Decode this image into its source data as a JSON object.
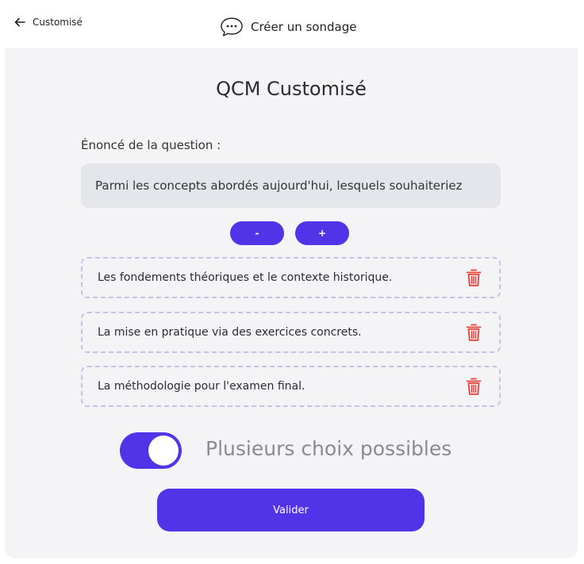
{
  "header": {
    "back_label": "Customisé",
    "title": "Créer un sondage"
  },
  "page_title": "QCM Customisé",
  "question": {
    "label": "Énoncé de la question :",
    "value": "Parmi les concepts abordés aujourd'hui, lesquels souhaiteriez"
  },
  "controls": {
    "minus_label": "-",
    "plus_label": "+"
  },
  "options": [
    {
      "text": "Les fondements théoriques et le contexte historique."
    },
    {
      "text": "La mise en pratique via des exercices concrets."
    },
    {
      "text": "La méthodologie pour l'examen final."
    }
  ],
  "multiple_choice": {
    "label": "Plusieurs choix possibles",
    "enabled": true
  },
  "submit_label": "Valider",
  "colors": {
    "accent": "#5234e8",
    "delete": "#e5413b",
    "input_bg": "#e5e6ec"
  }
}
